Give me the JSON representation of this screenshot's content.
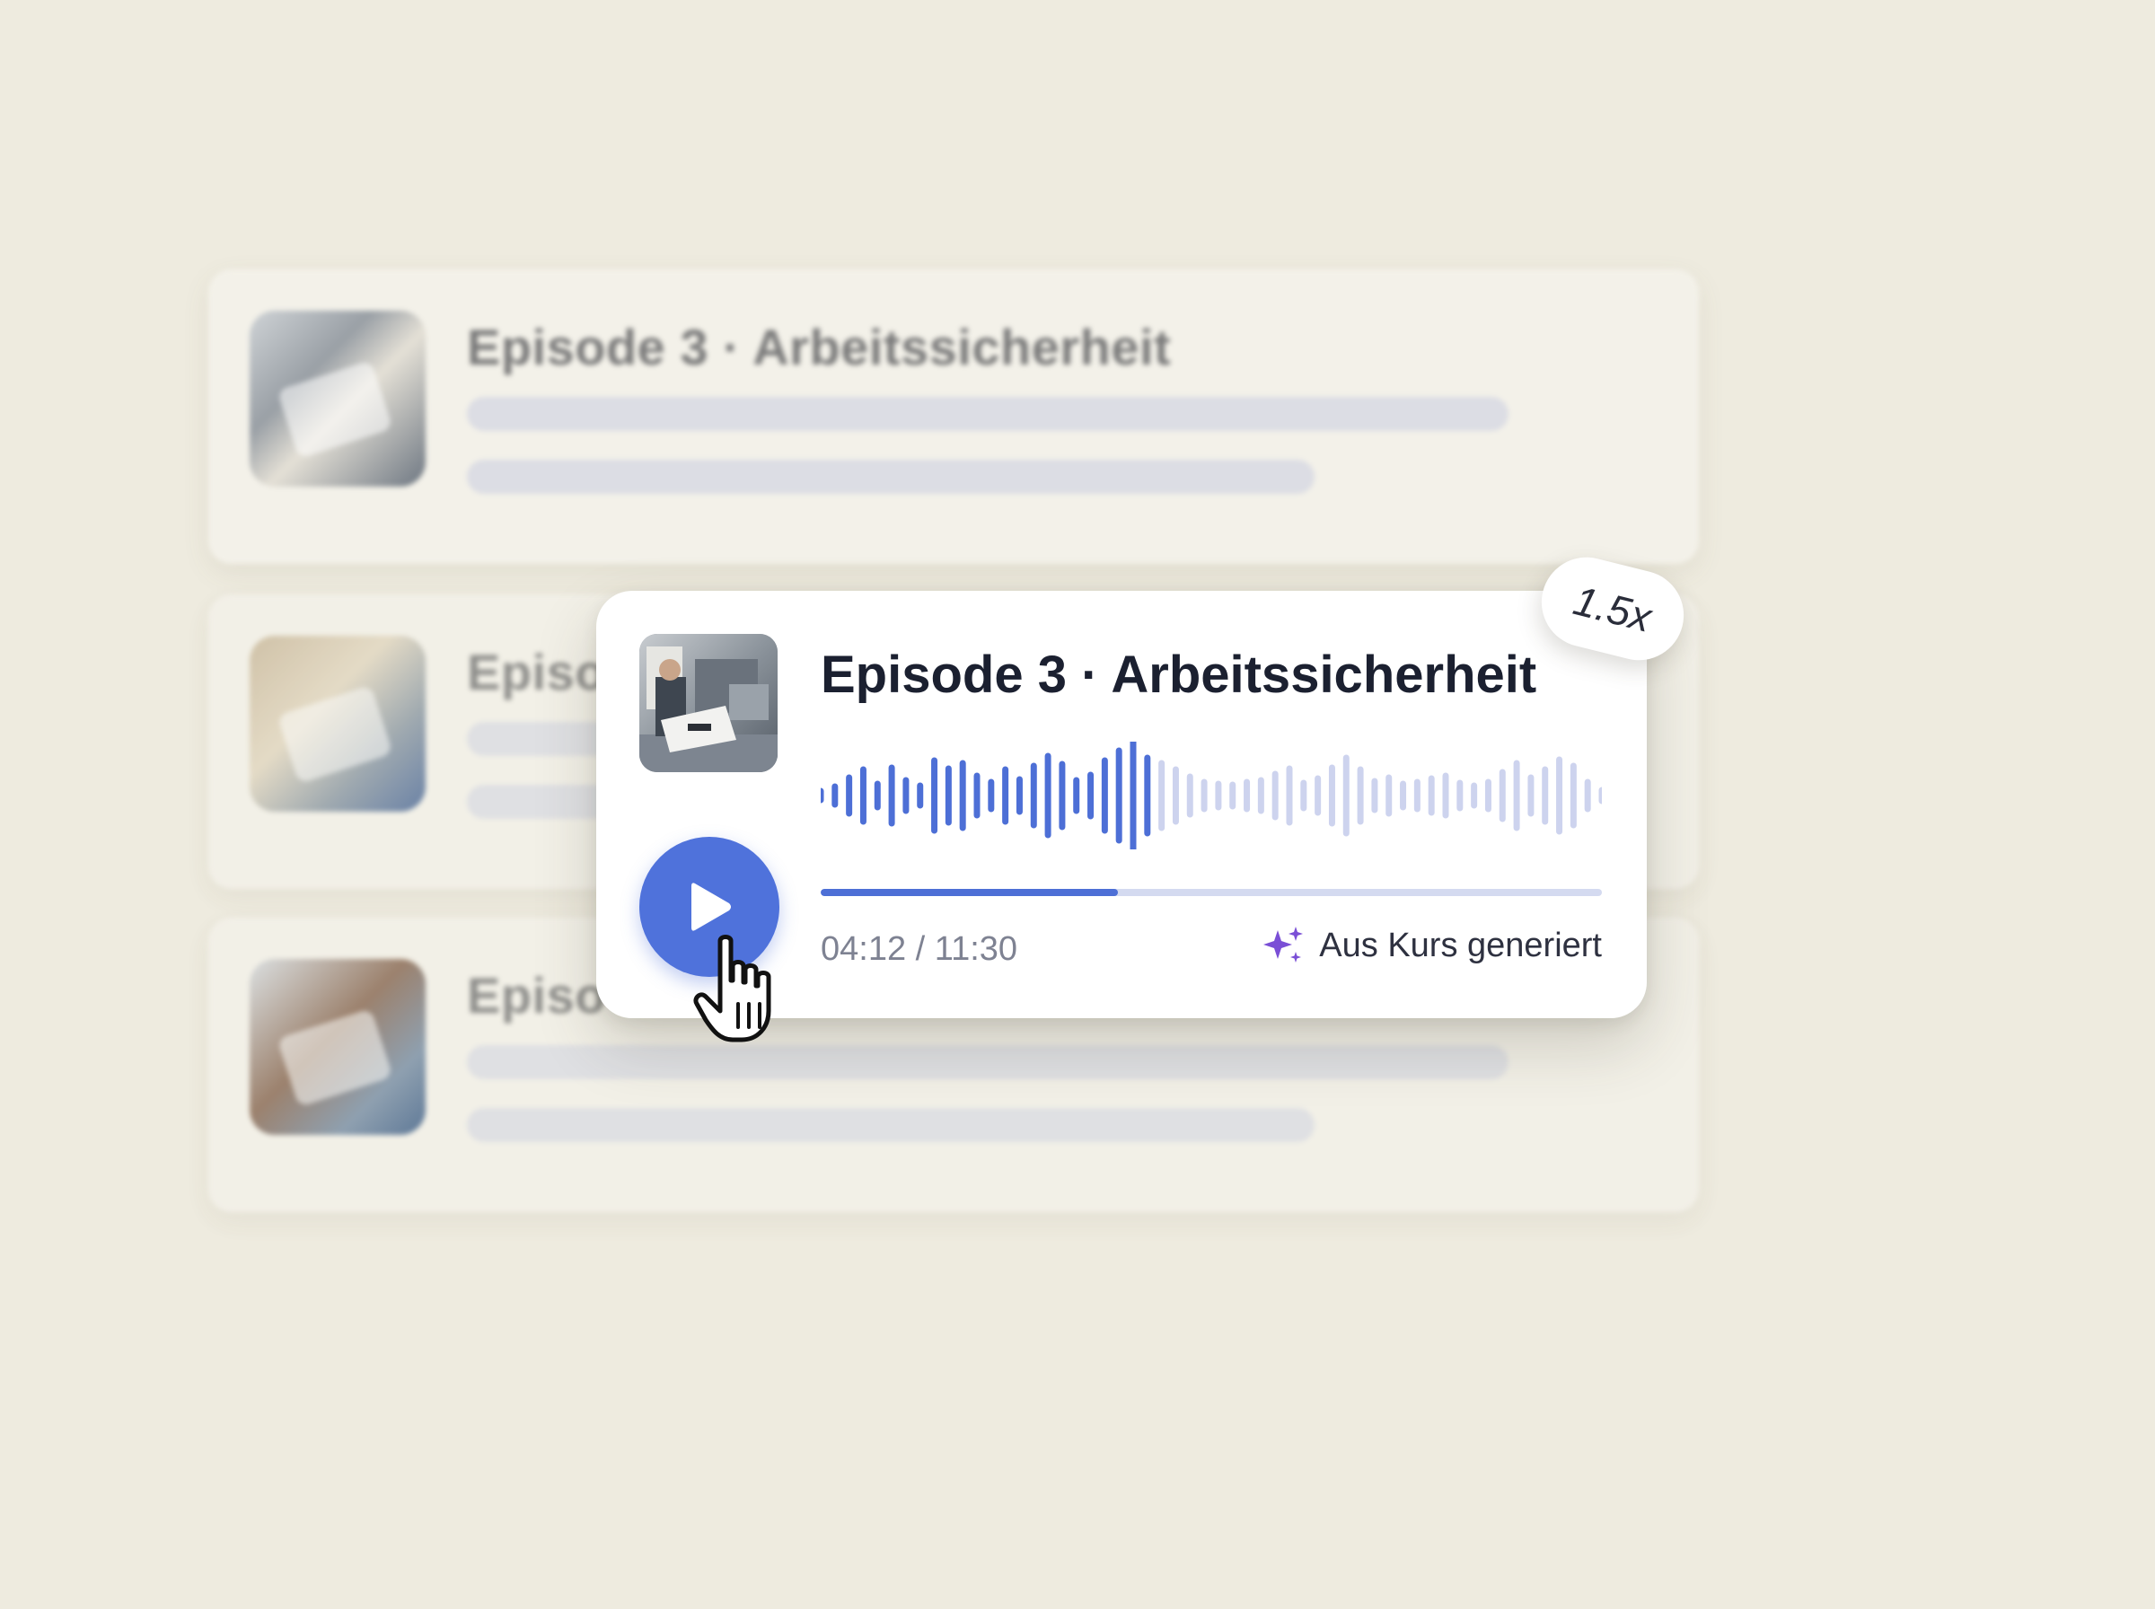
{
  "background_list": {
    "items": [
      {
        "title": "Episode 3 · Arbeitssicherheit"
      },
      {
        "title": "Episo"
      },
      {
        "title": "Episo"
      }
    ]
  },
  "player": {
    "title": "Episode 3 · Arbeitssicherheit",
    "current_time": "04:12",
    "total_time": "11:30",
    "time_display": "04:12 / 11:30",
    "progress": 0.38,
    "generated_label": "Aus Kurs generiert",
    "speed": "1.5x",
    "play_icon": "play-icon",
    "sparkle_icon": "sparkle-icon",
    "colors": {
      "accent": "#4f72db",
      "waveform_played": "#4d6fd6",
      "waveform_unplayed": "#cdd3ee",
      "sparkle": "#7a4fd6"
    }
  }
}
